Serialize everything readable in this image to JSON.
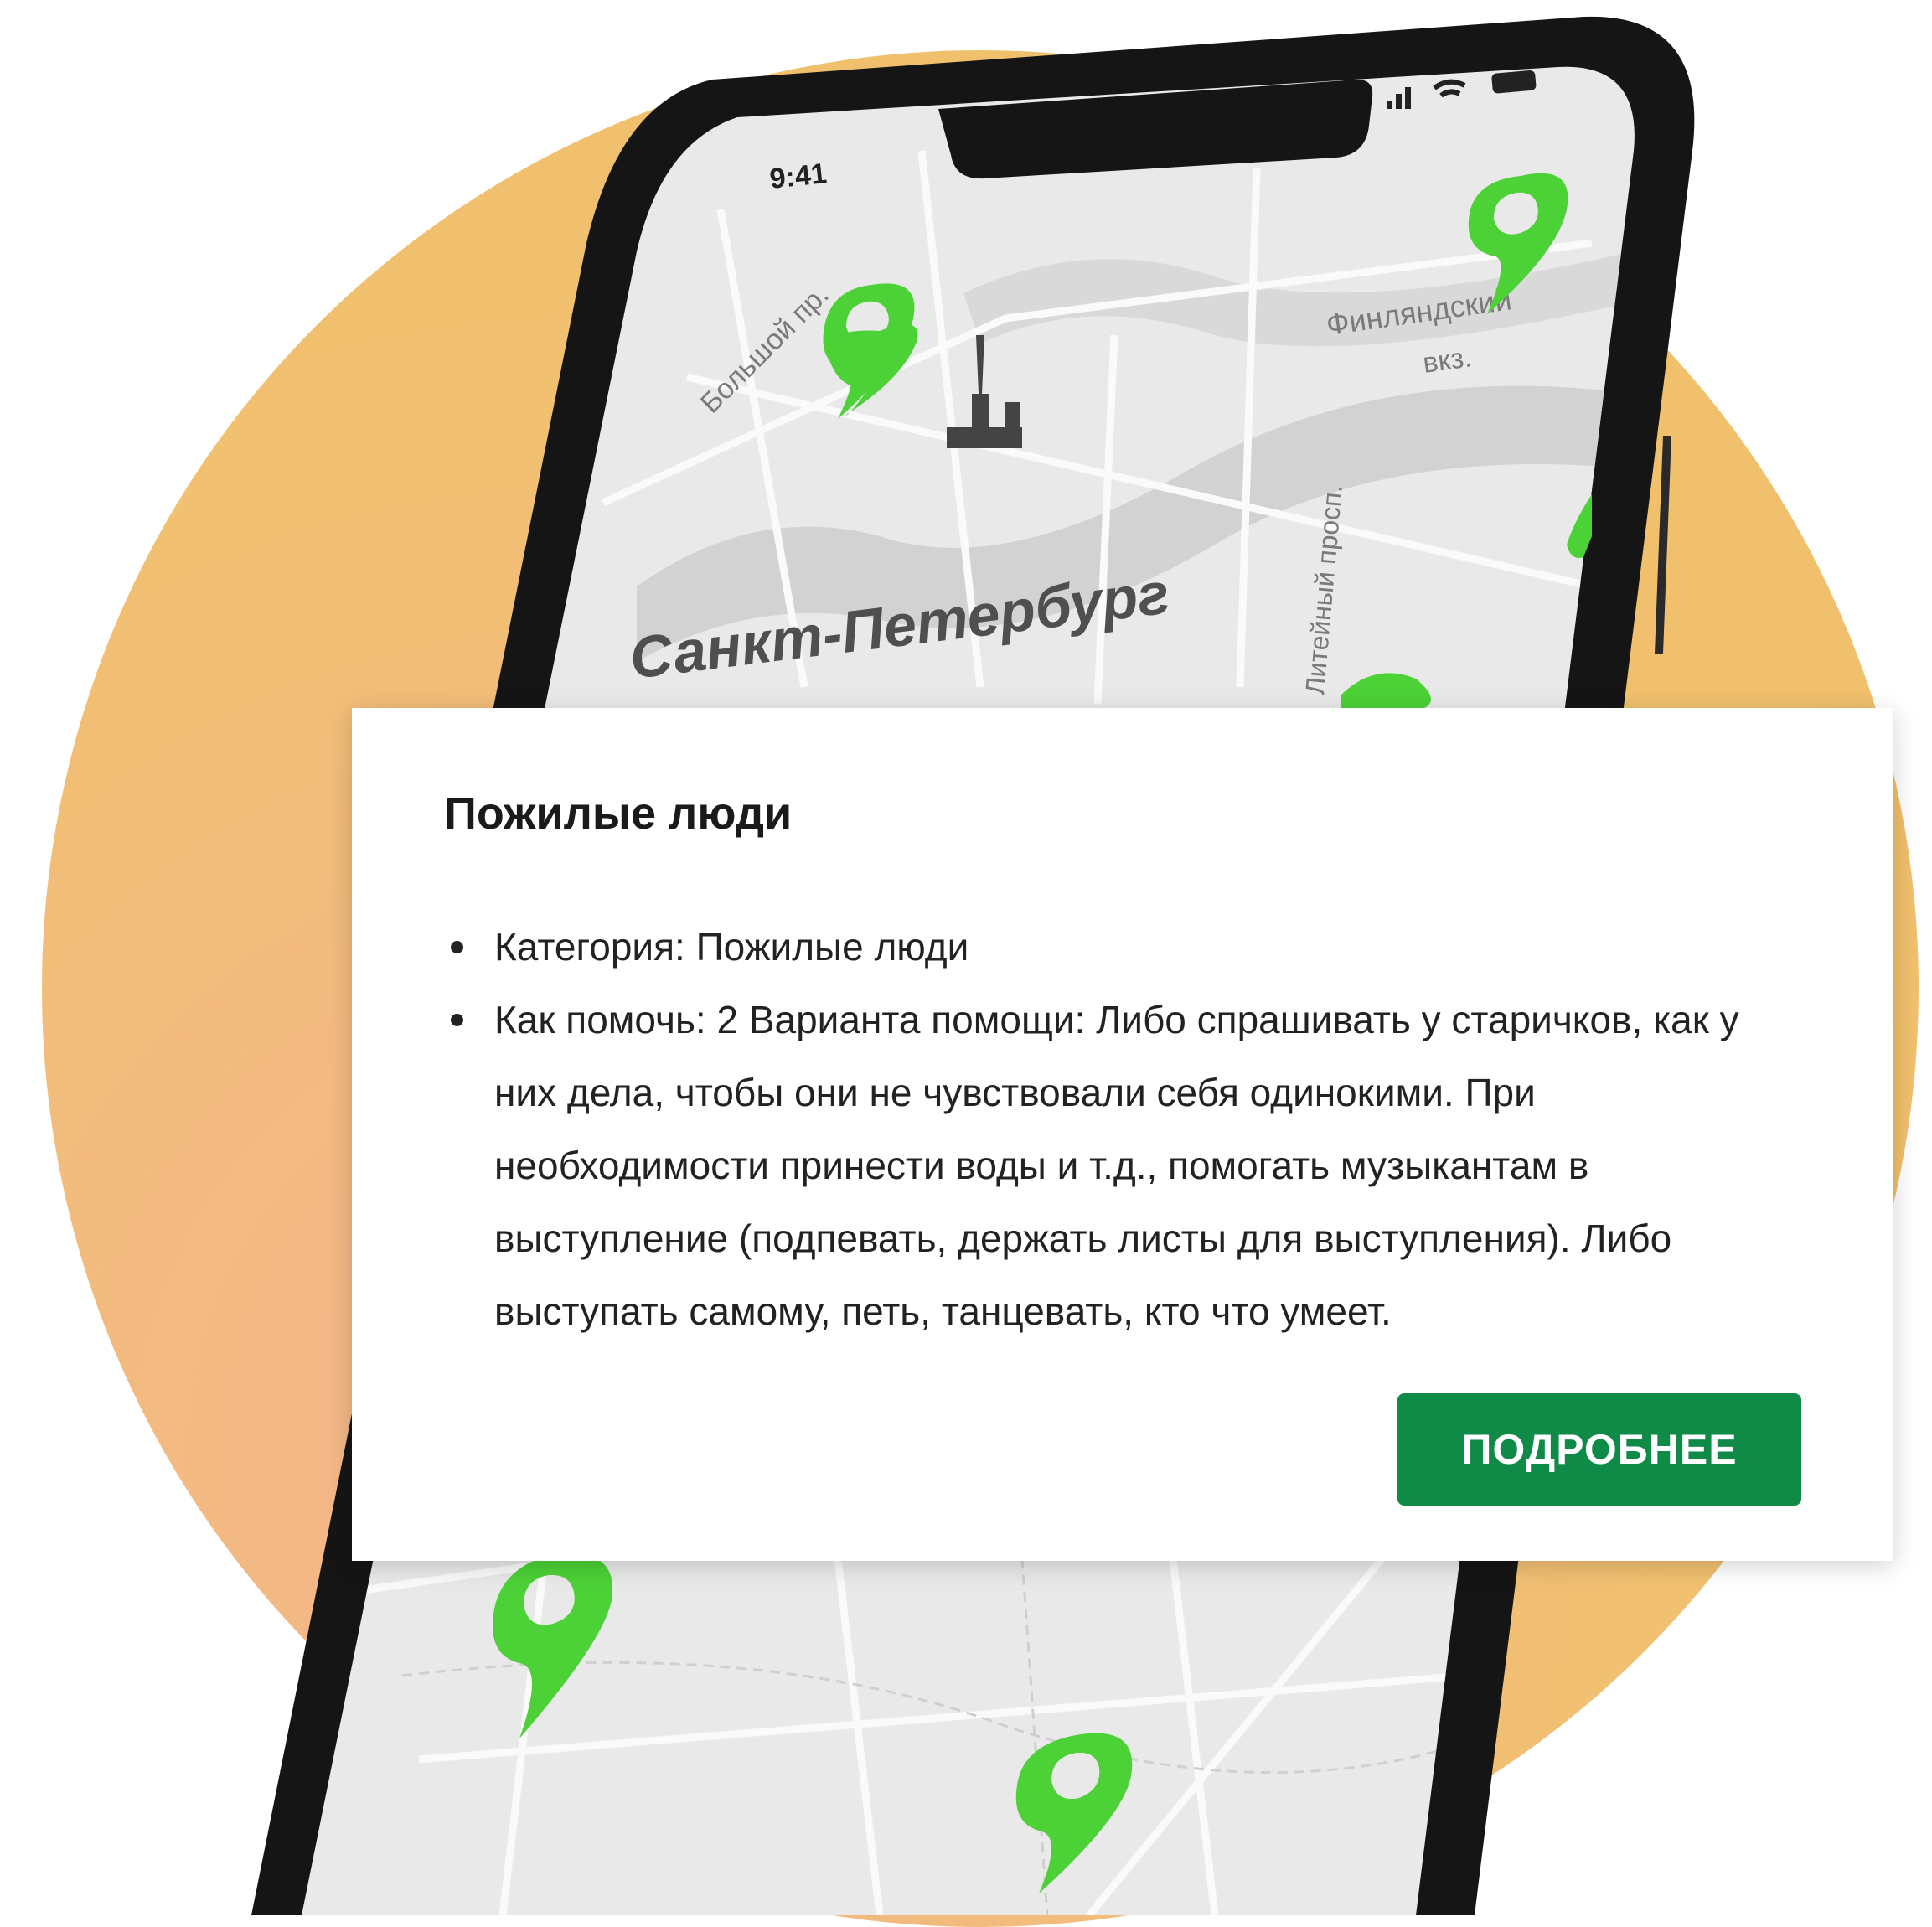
{
  "phone": {
    "status_time": "9:41"
  },
  "map": {
    "labels": {
      "bolshoi": "Большой пр.",
      "finland_1": "Финляндский",
      "finland_2": "вкз.",
      "liteyny": "Литейный просп.",
      "city": "Санкт-Петербург"
    }
  },
  "card": {
    "title": "Пожилые люди",
    "items": [
      {
        "label": "Категория: Пожилые люди"
      },
      {
        "label": "Как помочь: 2 Варианта помощи: Либо спрашивать у старичков, как у них дела, чтобы они не чувствовали себя одинокими. При необходимости принести воды и т.д., помогать музыкантам в выступление (подпевать, держать листы для выступления). Либо выступать самому, петь, танцевать, кто что умеет."
      }
    ],
    "button_label": "ПОДРОБНЕЕ"
  },
  "colors": {
    "accent_green": "#0f8a47",
    "pin_green": "#4cd137",
    "background_orange": "#f1c070"
  }
}
